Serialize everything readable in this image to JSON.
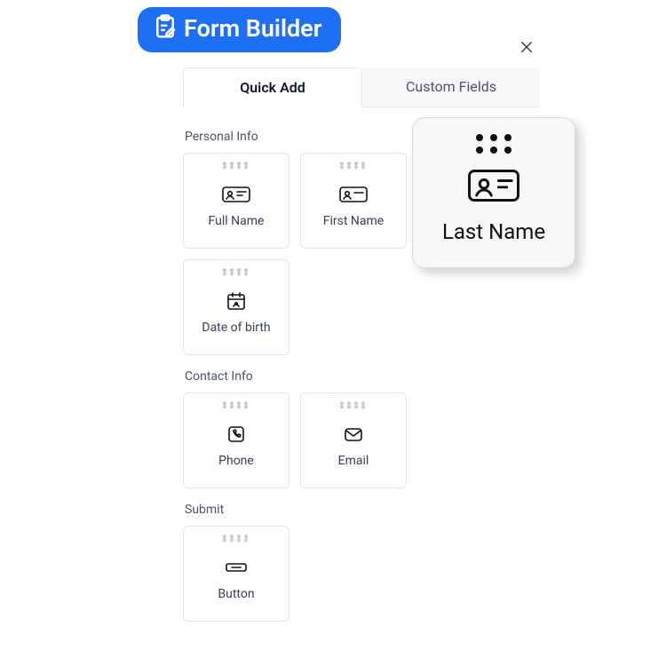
{
  "badge": {
    "title": "Form Builder"
  },
  "tabs": {
    "quick_add": "Quick Add",
    "custom_fields": "Custom Fields"
  },
  "sections": {
    "personal": {
      "title": "Personal Info",
      "full_name": "Full Name",
      "first_name": "First Name",
      "last_name": "Last Name",
      "dob": "Date of birth"
    },
    "contact": {
      "title": "Contact Info",
      "phone": "Phone",
      "email": "Email"
    },
    "submit": {
      "title": "Submit",
      "button": "Button"
    }
  }
}
